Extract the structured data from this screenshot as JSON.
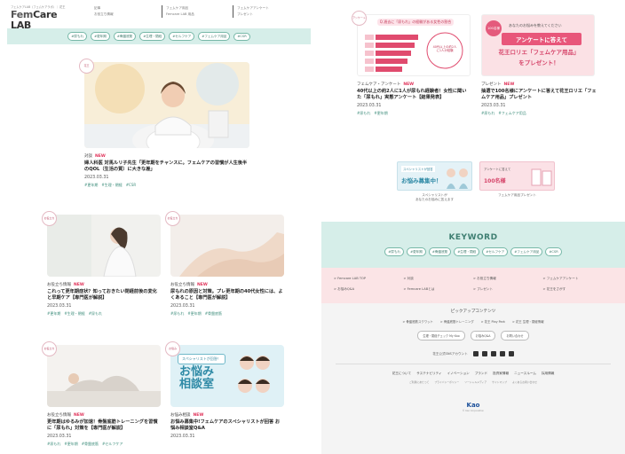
{
  "header": {
    "tagline": "フェムケアLAB（フェムケアラボ）｜ 花王",
    "brand_prefix": "Fem",
    "brand_suffix": "Care LAB",
    "nav": [
      {
        "line1": "記事",
        "line2": "お役立ち情報"
      },
      {
        "line1": "フェムケア用品",
        "line2": "Femcare LAB 用品"
      },
      {
        "line1": "フェムケアアンケート",
        "line2": "プレゼント"
      }
    ]
  },
  "tag_pills": [
    "#尿もれ",
    "#更年期",
    "#骨盤底筋",
    "#生理・閉経",
    "#セルフケア",
    "#フェムケア用品",
    "#CSR"
  ],
  "featured": {
    "badge": "花王",
    "category": "対談",
    "new": "NEW",
    "title": "婦人科医 対馬ルリ子先生「更年期をチャンスに。フェムケアの習慣が人生後半のQOL（生活の質）に大きな差」",
    "date": "2023.03.31",
    "tags": "#更年期　#生理・閉経　#CSR"
  },
  "cards": [
    {
      "badge": "お役立ち",
      "category": "お役立ち情報",
      "new": "NEW",
      "title": "これって更年期症状？知っておきたい閉経前後の変化と早期ケア【専門医が解説】",
      "date": "2023.03.31",
      "tags": "#更年期　#生理・閉経　#尿もれ"
    },
    {
      "badge": "お役立ち",
      "category": "お役立ち情報",
      "new": "NEW",
      "title": "尿もれの原因と対策。プレ更年期の40代女性には、よくあること【専門医が解説】",
      "date": "2023.03.31",
      "tags": "#尿もれ　#更年期　#骨盤底筋"
    },
    {
      "badge": "お役立ち",
      "category": "お役立ち情報",
      "new": "NEW",
      "title": "更年期はゆるみが加速！骨盤底筋トレーニングを習慣に「尿もれ」対策を【専門医が解説】",
      "date": "2023.03.31",
      "tags": "#尿もれ　#更年期　#骨盤底筋　#セルフケア"
    },
    {
      "badge": "お悩み",
      "category": "お悩み相談",
      "new": "NEW",
      "title": "お悩み募集中!フェムケアのスペシャリストが回答 お悩み相談室Q&A",
      "date": "2023.03.31",
      "tags": "",
      "banner_line1": "スペシャリストが回答！",
      "banner_line2": "お悩み",
      "banner_line3": "相談室"
    }
  ],
  "right_cards": [
    {
      "badge": "アンケート",
      "category": "フェムケア・アンケート",
      "new": "NEW",
      "title": "40代以上の約2人に1人が尿もれ経験者！女性に聞いた「尿もれ」実態アンケート【結果発表】",
      "date": "2023.03.31",
      "tags": "#尿もれ　#更年期",
      "chart_title": "Q.過去に「尿もれ」の経験がある女性の割合",
      "chart_note": "40代以上の約2人に1人が経験"
    },
    {
      "category": "プレゼント",
      "new": "NEW",
      "title": "抽選で100名様にアンケートに答えて花王ロリエ「フェムケア用品」プレゼント",
      "date": "2023.03.31",
      "tags": "#尿もれ　#フェムケア用品",
      "promo_line1": "あなたのお悩みを教えてください",
      "promo_line2": "アンケートに答えて",
      "promo_line3": "花王ロリエ「フェムケア用品」",
      "promo_line4": "をプレゼント！",
      "promo_badge": "100名様"
    }
  ],
  "banners": [
    {
      "img_line1": "スペシャリストが回答",
      "img_line2": "お悩み募集中！",
      "caption": "スペシャリストが\nあなたのお悩みに答えます"
    },
    {
      "img_line1": "100名様",
      "img_line2": "アンケートに答えて",
      "caption": "フェムケア用品プレゼント"
    }
  ],
  "keyword": {
    "title": "KEYWORD",
    "tags": [
      "#尿もれ",
      "#更年期",
      "#骨盤底筋",
      "#生理・閉経",
      "#セルフケア",
      "#フェムケア用品",
      "#CSR"
    ]
  },
  "footer_links_row1": [
    "> Femcare LAB TOP",
    "> 対談",
    "> お役立ち情報",
    "> フェムケアアンケート"
  ],
  "footer_links_row2": [
    "> お悩みQ&A",
    "> Femcare LABとは",
    "> プレゼント",
    "> 花王をさがす"
  ],
  "pickup": {
    "title": "ピックアップコンテンツ",
    "links": [
      "> 骨盤底筋スクワット",
      "> 骨盤底筋トレーニング",
      "> 花王 Play Park",
      "> 花王 生理・閉経情報"
    ],
    "buttons": [
      "生理・閉経チェック My Kao",
      "お悩みQ&A",
      "お問い合わせ"
    ]
  },
  "follow_label": "花王公式SNSアカウント",
  "footer_links": [
    "花王について",
    "サステナビリティ",
    "イノベーション",
    "ブランド",
    "投資家情報",
    "ニュースルーム",
    "採用情報"
  ],
  "footer_links_small": [
    "ご利用にあたって",
    "プライバシーポリシー",
    "ソーシャルメディア",
    "サイトマップ",
    "よくあるお問い合わせ"
  ],
  "kao_logo": "Kao",
  "copyright": "© Kao Corporation"
}
